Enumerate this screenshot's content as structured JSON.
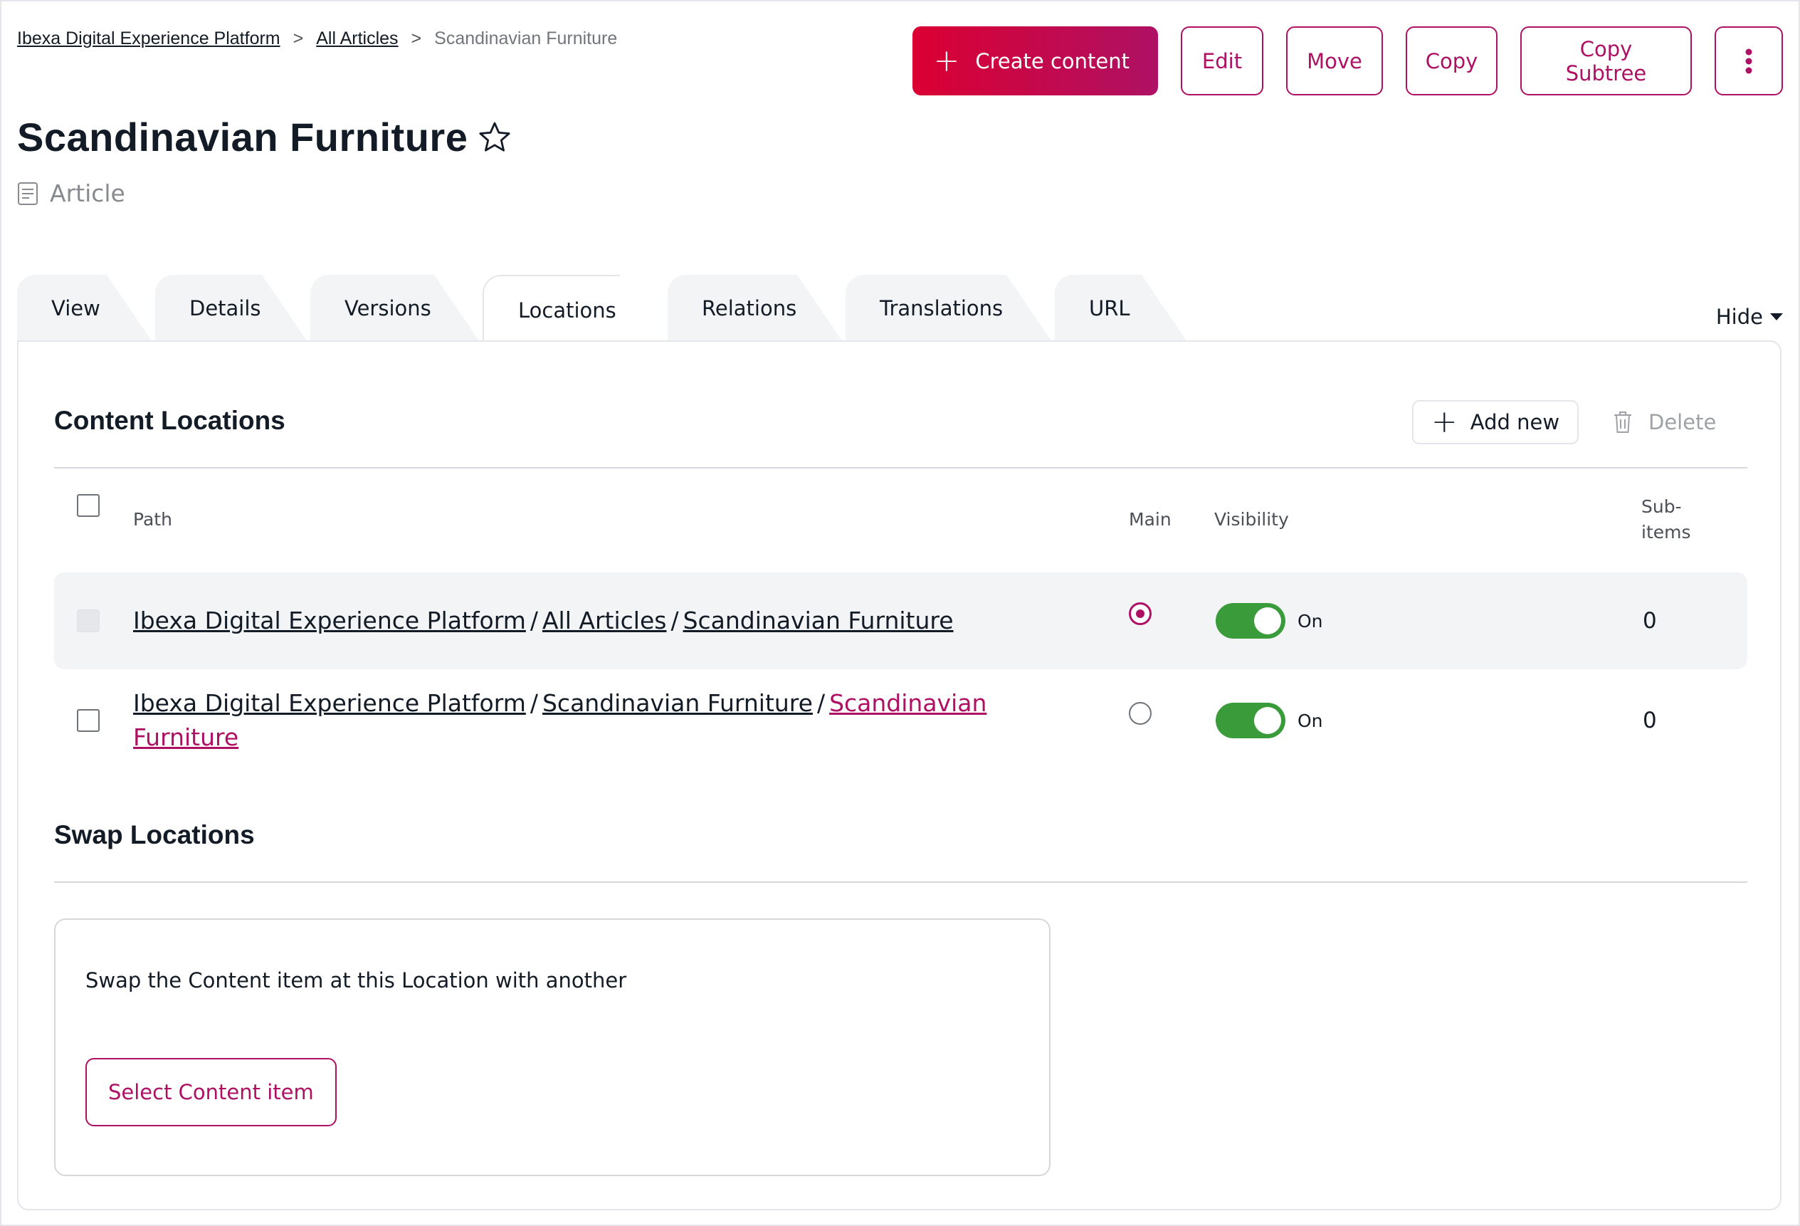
{
  "breadcrumb": {
    "items": [
      "Ibexa Digital Experience Platform",
      "All Articles"
    ],
    "current": "Scandinavian Furniture",
    "separator": ">"
  },
  "header": {
    "create_label": "Create content",
    "edit_label": "Edit",
    "move_label": "Move",
    "copy_label": "Copy",
    "copy_subtree_label": "Copy Subtree",
    "more_icon": "more-vertical-icon"
  },
  "content": {
    "title": "Scandinavian Furniture",
    "type": "Article",
    "bookmark_icon": "star-icon"
  },
  "tabs": [
    {
      "label": "View"
    },
    {
      "label": "Details"
    },
    {
      "label": "Versions"
    },
    {
      "label": "Locations",
      "active": true
    },
    {
      "label": "Relations"
    },
    {
      "label": "Translations"
    },
    {
      "label": "URL"
    }
  ],
  "hide_label": "Hide",
  "locations": {
    "title": "Content Locations",
    "add_new_label": "Add new",
    "delete_label": "Delete",
    "columns": {
      "path": "Path",
      "main": "Main",
      "visibility": "Visibility",
      "subitems_line1": "Sub-",
      "subitems_line2": "items"
    },
    "rows": [
      {
        "path": [
          "Ibexa Digital Experience Platform",
          "All Articles",
          "Scandinavian Furniture"
        ],
        "main": true,
        "visibility": "On",
        "subitems": "0"
      },
      {
        "path": [
          "Ibexa Digital Experience Platform",
          "Scandinavian Furniture",
          "Scandinavian",
          "Furniture"
        ],
        "main": false,
        "visibility": "On",
        "subitems": "0"
      }
    ]
  },
  "swap": {
    "title": "Swap Locations",
    "description": "Swap the Content item at this Location with another",
    "select_label": "Select Content item"
  },
  "colors": {
    "accent": "#ae1164",
    "primary_gradient_start": "#db0032",
    "toggle_on": "#3a9b3a"
  }
}
